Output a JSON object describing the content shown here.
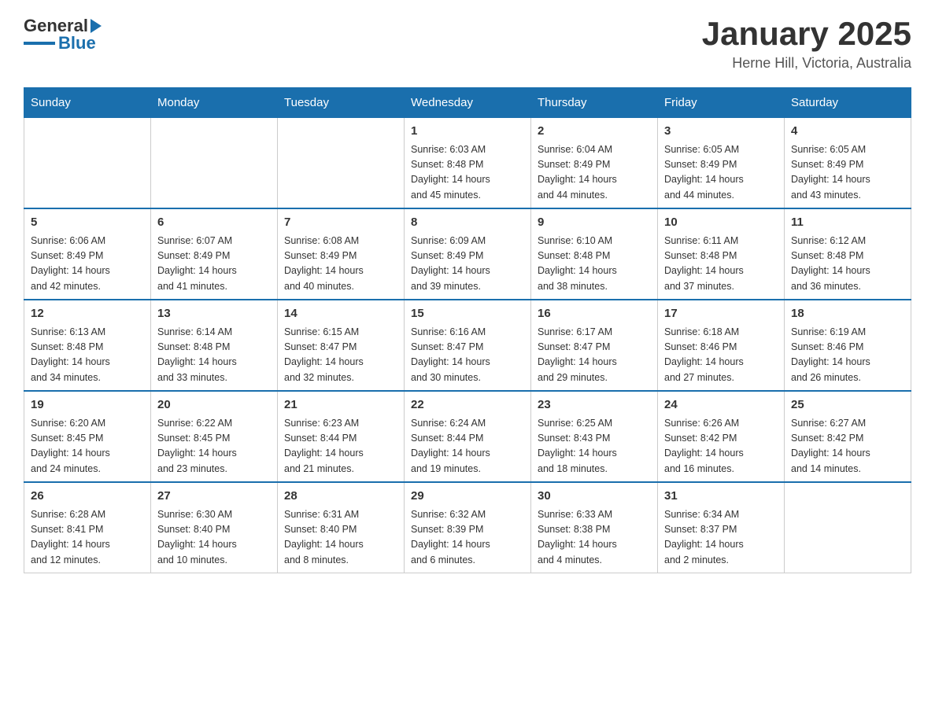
{
  "header": {
    "logo_line1": "General",
    "logo_line2": "Blue",
    "title": "January 2025",
    "subtitle": "Herne Hill, Victoria, Australia"
  },
  "days_of_week": [
    "Sunday",
    "Monday",
    "Tuesday",
    "Wednesday",
    "Thursday",
    "Friday",
    "Saturday"
  ],
  "weeks": [
    [
      {
        "num": "",
        "info": ""
      },
      {
        "num": "",
        "info": ""
      },
      {
        "num": "",
        "info": ""
      },
      {
        "num": "1",
        "info": "Sunrise: 6:03 AM\nSunset: 8:48 PM\nDaylight: 14 hours\nand 45 minutes."
      },
      {
        "num": "2",
        "info": "Sunrise: 6:04 AM\nSunset: 8:49 PM\nDaylight: 14 hours\nand 44 minutes."
      },
      {
        "num": "3",
        "info": "Sunrise: 6:05 AM\nSunset: 8:49 PM\nDaylight: 14 hours\nand 44 minutes."
      },
      {
        "num": "4",
        "info": "Sunrise: 6:05 AM\nSunset: 8:49 PM\nDaylight: 14 hours\nand 43 minutes."
      }
    ],
    [
      {
        "num": "5",
        "info": "Sunrise: 6:06 AM\nSunset: 8:49 PM\nDaylight: 14 hours\nand 42 minutes."
      },
      {
        "num": "6",
        "info": "Sunrise: 6:07 AM\nSunset: 8:49 PM\nDaylight: 14 hours\nand 41 minutes."
      },
      {
        "num": "7",
        "info": "Sunrise: 6:08 AM\nSunset: 8:49 PM\nDaylight: 14 hours\nand 40 minutes."
      },
      {
        "num": "8",
        "info": "Sunrise: 6:09 AM\nSunset: 8:49 PM\nDaylight: 14 hours\nand 39 minutes."
      },
      {
        "num": "9",
        "info": "Sunrise: 6:10 AM\nSunset: 8:48 PM\nDaylight: 14 hours\nand 38 minutes."
      },
      {
        "num": "10",
        "info": "Sunrise: 6:11 AM\nSunset: 8:48 PM\nDaylight: 14 hours\nand 37 minutes."
      },
      {
        "num": "11",
        "info": "Sunrise: 6:12 AM\nSunset: 8:48 PM\nDaylight: 14 hours\nand 36 minutes."
      }
    ],
    [
      {
        "num": "12",
        "info": "Sunrise: 6:13 AM\nSunset: 8:48 PM\nDaylight: 14 hours\nand 34 minutes."
      },
      {
        "num": "13",
        "info": "Sunrise: 6:14 AM\nSunset: 8:48 PM\nDaylight: 14 hours\nand 33 minutes."
      },
      {
        "num": "14",
        "info": "Sunrise: 6:15 AM\nSunset: 8:47 PM\nDaylight: 14 hours\nand 32 minutes."
      },
      {
        "num": "15",
        "info": "Sunrise: 6:16 AM\nSunset: 8:47 PM\nDaylight: 14 hours\nand 30 minutes."
      },
      {
        "num": "16",
        "info": "Sunrise: 6:17 AM\nSunset: 8:47 PM\nDaylight: 14 hours\nand 29 minutes."
      },
      {
        "num": "17",
        "info": "Sunrise: 6:18 AM\nSunset: 8:46 PM\nDaylight: 14 hours\nand 27 minutes."
      },
      {
        "num": "18",
        "info": "Sunrise: 6:19 AM\nSunset: 8:46 PM\nDaylight: 14 hours\nand 26 minutes."
      }
    ],
    [
      {
        "num": "19",
        "info": "Sunrise: 6:20 AM\nSunset: 8:45 PM\nDaylight: 14 hours\nand 24 minutes."
      },
      {
        "num": "20",
        "info": "Sunrise: 6:22 AM\nSunset: 8:45 PM\nDaylight: 14 hours\nand 23 minutes."
      },
      {
        "num": "21",
        "info": "Sunrise: 6:23 AM\nSunset: 8:44 PM\nDaylight: 14 hours\nand 21 minutes."
      },
      {
        "num": "22",
        "info": "Sunrise: 6:24 AM\nSunset: 8:44 PM\nDaylight: 14 hours\nand 19 minutes."
      },
      {
        "num": "23",
        "info": "Sunrise: 6:25 AM\nSunset: 8:43 PM\nDaylight: 14 hours\nand 18 minutes."
      },
      {
        "num": "24",
        "info": "Sunrise: 6:26 AM\nSunset: 8:42 PM\nDaylight: 14 hours\nand 16 minutes."
      },
      {
        "num": "25",
        "info": "Sunrise: 6:27 AM\nSunset: 8:42 PM\nDaylight: 14 hours\nand 14 minutes."
      }
    ],
    [
      {
        "num": "26",
        "info": "Sunrise: 6:28 AM\nSunset: 8:41 PM\nDaylight: 14 hours\nand 12 minutes."
      },
      {
        "num": "27",
        "info": "Sunrise: 6:30 AM\nSunset: 8:40 PM\nDaylight: 14 hours\nand 10 minutes."
      },
      {
        "num": "28",
        "info": "Sunrise: 6:31 AM\nSunset: 8:40 PM\nDaylight: 14 hours\nand 8 minutes."
      },
      {
        "num": "29",
        "info": "Sunrise: 6:32 AM\nSunset: 8:39 PM\nDaylight: 14 hours\nand 6 minutes."
      },
      {
        "num": "30",
        "info": "Sunrise: 6:33 AM\nSunset: 8:38 PM\nDaylight: 14 hours\nand 4 minutes."
      },
      {
        "num": "31",
        "info": "Sunrise: 6:34 AM\nSunset: 8:37 PM\nDaylight: 14 hours\nand 2 minutes."
      },
      {
        "num": "",
        "info": ""
      }
    ]
  ]
}
